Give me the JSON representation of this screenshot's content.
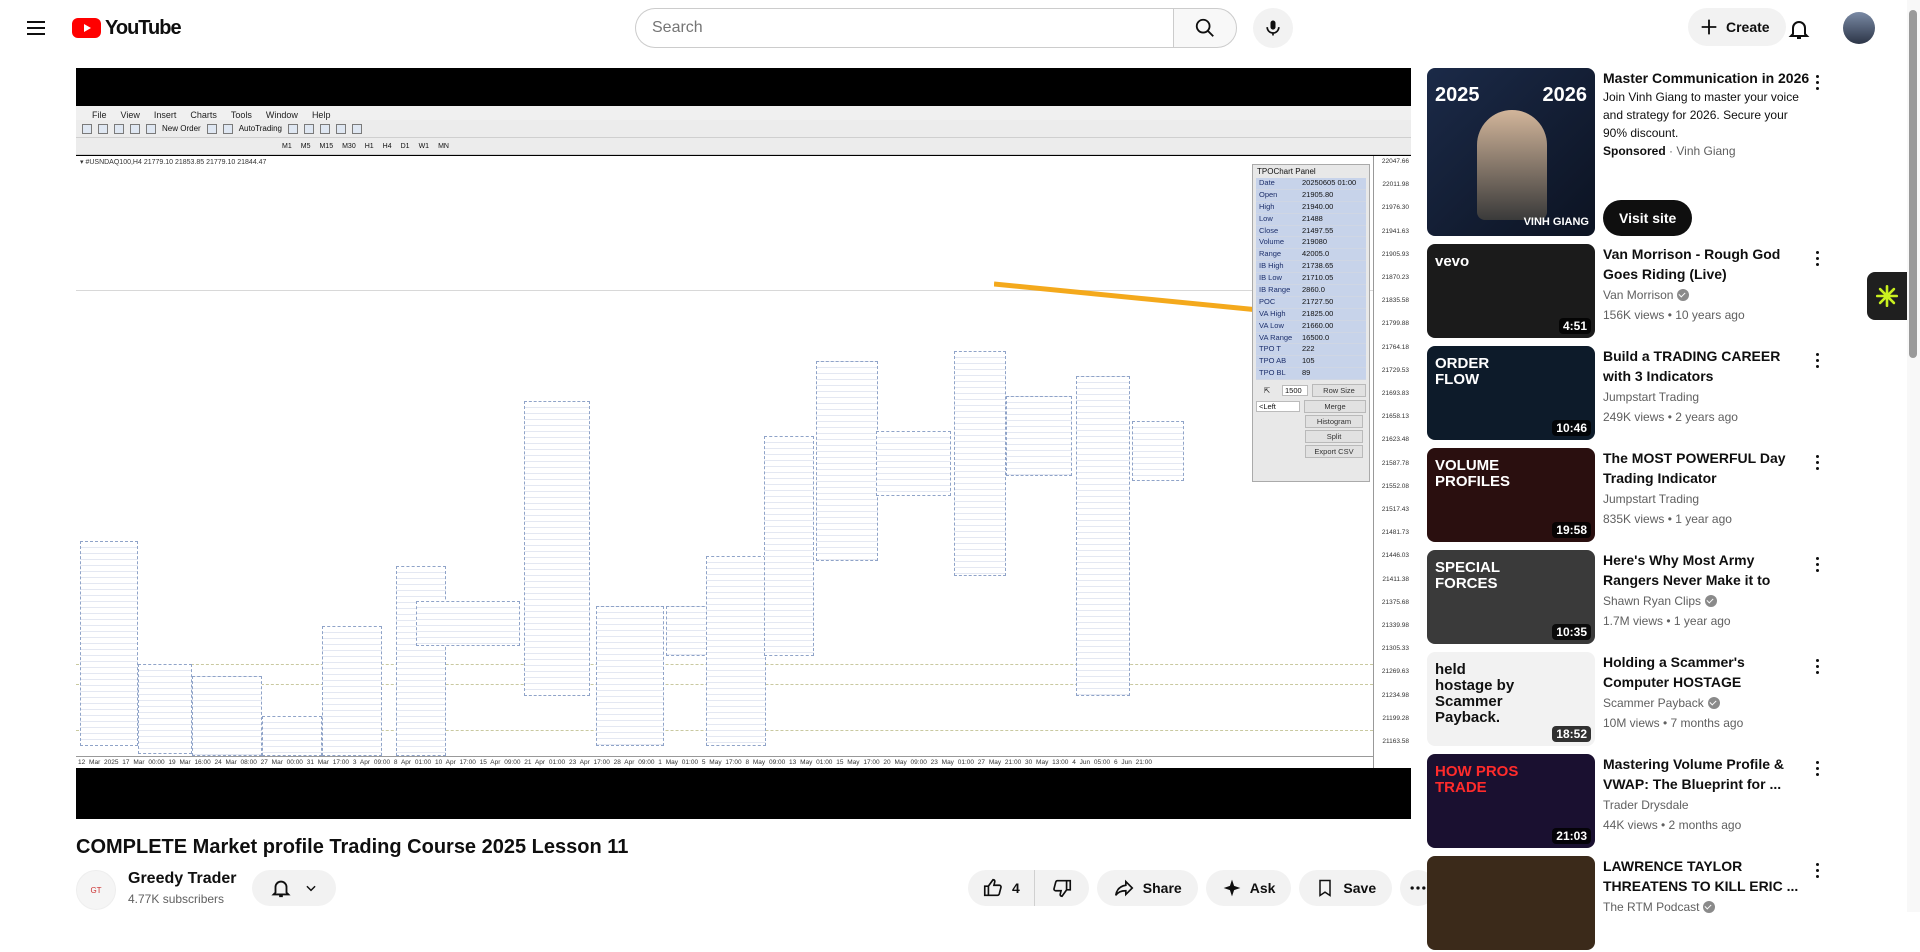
{
  "header": {
    "logo_text": "YouTube",
    "search_placeholder": "Search",
    "create_label": "Create"
  },
  "video": {
    "title": "COMPLETE Market profile Trading Course 2025 Lesson 11",
    "channel": "Greedy Trader",
    "subscribers": "4.77K subscribers",
    "likes": "4",
    "share_label": "Share",
    "ask_label": "Ask",
    "save_label": "Save"
  },
  "player": {
    "menu": [
      "File",
      "View",
      "Insert",
      "Charts",
      "Tools",
      "Window",
      "Help"
    ],
    "toolbar_new_order": "New Order",
    "toolbar_autotrading": "AutoTrading",
    "timeframes": [
      "M1",
      "M5",
      "M15",
      "M30",
      "H1",
      "H4",
      "D1",
      "W1",
      "MN"
    ],
    "symbol_line": "▾ #USNDAQ100,H4  21779.10 21853.85 21779.10 21844.47",
    "price_ticks": [
      "22047.66",
      "22011.98",
      "21976.30",
      "21941.63",
      "21905.93",
      "21870.23",
      "21835.58",
      "21799.88",
      "21764.18",
      "21729.53",
      "21693.83",
      "21658.13",
      "21623.48",
      "21587.78",
      "21552.08",
      "21517.43",
      "21481.73",
      "21446.03",
      "21411.38",
      "21375.68",
      "21339.98",
      "21305.33",
      "21269.63",
      "21234.98",
      "21199.28",
      "21163.58"
    ],
    "time_axis": "12 Mar 2025   17 Mar 00:00   19 Mar 16:00   24 Mar 08:00   27 Mar 00:00   31 Mar 17:00   3 Apr 09:00   8 Apr 01:00   10 Apr 17:00   15 Apr 09:00   21 Apr 01:00   23 Apr 17:00   28 Apr 09:00   1 May 01:00   5 May 17:00   8 May 09:00   13 May 01:00   15 May 17:00   20 May 09:00   23 May 01:00   27 May 21:00   30 May 13:00   4 Jun 05:00   6 Jun 21:00",
    "tpo_panel": {
      "title": "TPOChart Panel",
      "rows": [
        {
          "k": "Date",
          "v": "20250605 01:00"
        },
        {
          "k": "Open",
          "v": "21905.80"
        },
        {
          "k": "High",
          "v": "21940.00"
        },
        {
          "k": "Low",
          "v": "21488"
        },
        {
          "k": "Close",
          "v": "21497.55"
        },
        {
          "k": "Volume",
          "v": "219080"
        },
        {
          "k": "Range",
          "v": "42005.0"
        },
        {
          "k": "IB High",
          "v": "21738.65"
        },
        {
          "k": "IB Low",
          "v": "21710.05"
        },
        {
          "k": "IB Range",
          "v": "2860.0"
        },
        {
          "k": "POC",
          "v": "21727.50"
        },
        {
          "k": "VA High",
          "v": "21825.00"
        },
        {
          "k": "VA Low",
          "v": "21660.00"
        },
        {
          "k": "VA Range",
          "v": "16500.0"
        },
        {
          "k": "TPO T",
          "v": "222"
        },
        {
          "k": "TPO AB",
          "v": "105"
        },
        {
          "k": "TPO BL",
          "v": "89"
        }
      ],
      "row_size_value": "1500",
      "buttons": [
        "Row Size",
        "Merge",
        "Histogram",
        "Split",
        "Export CSV"
      ],
      "left_select": "<Left"
    }
  },
  "sidebar": {
    "ad": {
      "title": "Master Communication in 2026",
      "description": "Join Vinh Giang to master your voice and strategy for 2026. Secure your 90% discount.",
      "sponsored": "Sponsored",
      "advertiser": "Vinh Giang",
      "cta": "Visit site",
      "thumb_left_year": "2025",
      "thumb_right_year": "2026",
      "thumb_caption": "VINH GIANG"
    },
    "items": [
      {
        "title": "Van Morrison - Rough God Goes Riding (Live)",
        "channel": "Van Morrison",
        "verified": true,
        "meta": "156K views • 10 years ago",
        "duration": "4:51",
        "thumb_text": "vevo"
      },
      {
        "title": "Build a TRADING CAREER with 3 Indicators",
        "channel": "Jumpstart Trading",
        "verified": false,
        "meta": "249K views • 2 years ago",
        "duration": "10:46",
        "thumb_text": "ORDER FLOW"
      },
      {
        "title": "The MOST POWERFUL Day Trading Indicator",
        "channel": "Jumpstart Trading",
        "verified": false,
        "meta": "835K views • 1 year ago",
        "duration": "19:58",
        "thumb_text": "VOLUME PROFILES"
      },
      {
        "title": "Here's Why Most Army Rangers Never Make it to Special Force...",
        "channel": "Shawn Ryan Clips",
        "verified": true,
        "meta": "1.7M views • 1 year ago",
        "duration": "10:35",
        "thumb_text": "SPECIAL FORCES"
      },
      {
        "title": "Holding a Scammer's Computer HOSTAGE",
        "channel": "Scammer Payback",
        "verified": true,
        "meta": "10M views • 7 months ago",
        "duration": "18:52",
        "thumb_text": "held hostage by Scammer Payback."
      },
      {
        "title": "Mastering Volume Profile & VWAP: The Blueprint for ...",
        "channel": "Trader Drysdale",
        "verified": false,
        "meta": "44K views • 2 months ago",
        "duration": "21:03",
        "thumb_text": "HOW PROS TRADE"
      },
      {
        "title": "LAWRENCE TAYLOR THREATENS TO KILL ERIC ...",
        "channel": "The RTM Podcast",
        "verified": true,
        "meta": "",
        "duration": "",
        "thumb_text": ""
      }
    ]
  },
  "colors": {
    "brand_red": "#ff0000",
    "tpo_highlight": "#c7d3ea",
    "arrow": "#f4a91c"
  }
}
